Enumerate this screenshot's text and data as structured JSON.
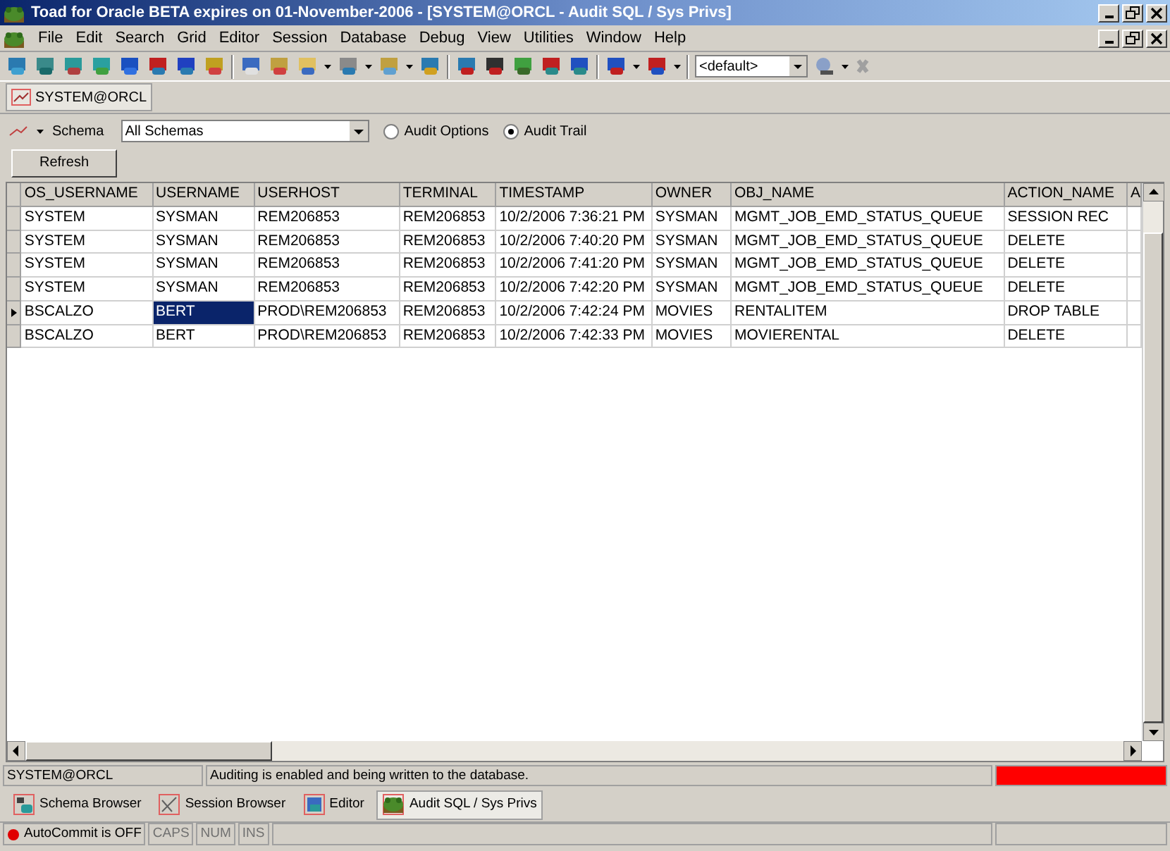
{
  "window": {
    "title": "Toad for Oracle BETA expires on 01-November-2006 - [SYSTEM@ORCL - Audit SQL / Sys Privs]"
  },
  "menu": [
    "File",
    "Edit",
    "Search",
    "Grid",
    "Editor",
    "Session",
    "Database",
    "Debug",
    "View",
    "Utilities",
    "Window",
    "Help"
  ],
  "toolbar": {
    "combo_value": "<default>"
  },
  "connection_tab": {
    "label": "SYSTEM@ORCL"
  },
  "options": {
    "schema_label": "Schema",
    "schema_value": "All Schemas",
    "radios": [
      {
        "label": "Audit Options",
        "selected": false
      },
      {
        "label": "Audit Trail",
        "selected": true
      }
    ]
  },
  "refresh_button": "Refresh",
  "table": {
    "columns": [
      "OS_USERNAME",
      "USERNAME",
      "USERHOST",
      "TERMINAL",
      "TIMESTAMP",
      "OWNER",
      "OBJ_NAME",
      "ACTION_NAME",
      "A"
    ],
    "rows": [
      {
        "current": false,
        "cells": [
          {
            "text": "SYSTEM",
            "selected": false
          },
          {
            "text": "SYSMAN",
            "selected": false
          },
          {
            "text": "REM206853",
            "selected": false
          },
          {
            "text": "REM206853",
            "selected": false
          },
          {
            "text": "10/2/2006 7:36:21 PM",
            "selected": false
          },
          {
            "text": "SYSMAN",
            "selected": false
          },
          {
            "text": "MGMT_JOB_EMD_STATUS_QUEUE",
            "selected": false
          },
          {
            "text": "SESSION REC",
            "selected": false
          }
        ]
      },
      {
        "current": false,
        "cells": [
          {
            "text": "SYSTEM",
            "selected": false
          },
          {
            "text": "SYSMAN",
            "selected": false
          },
          {
            "text": "REM206853",
            "selected": false
          },
          {
            "text": "REM206853",
            "selected": false
          },
          {
            "text": "10/2/2006 7:40:20 PM",
            "selected": false
          },
          {
            "text": "SYSMAN",
            "selected": false
          },
          {
            "text": "MGMT_JOB_EMD_STATUS_QUEUE",
            "selected": false
          },
          {
            "text": "DELETE",
            "selected": false
          }
        ]
      },
      {
        "current": false,
        "cells": [
          {
            "text": "SYSTEM",
            "selected": false
          },
          {
            "text": "SYSMAN",
            "selected": false
          },
          {
            "text": "REM206853",
            "selected": false
          },
          {
            "text": "REM206853",
            "selected": false
          },
          {
            "text": "10/2/2006 7:41:20 PM",
            "selected": false
          },
          {
            "text": "SYSMAN",
            "selected": false
          },
          {
            "text": "MGMT_JOB_EMD_STATUS_QUEUE",
            "selected": false
          },
          {
            "text": "DELETE",
            "selected": false
          }
        ]
      },
      {
        "current": false,
        "cells": [
          {
            "text": "SYSTEM",
            "selected": false
          },
          {
            "text": "SYSMAN",
            "selected": false
          },
          {
            "text": "REM206853",
            "selected": false
          },
          {
            "text": "REM206853",
            "selected": false
          },
          {
            "text": "10/2/2006 7:42:20 PM",
            "selected": false
          },
          {
            "text": "SYSMAN",
            "selected": false
          },
          {
            "text": "MGMT_JOB_EMD_STATUS_QUEUE",
            "selected": false
          },
          {
            "text": "DELETE",
            "selected": false
          }
        ]
      },
      {
        "current": true,
        "cells": [
          {
            "text": "BSCALZO",
            "selected": false
          },
          {
            "text": "BERT",
            "selected": true
          },
          {
            "text": "PROD\\REM206853",
            "selected": false
          },
          {
            "text": "REM206853",
            "selected": false
          },
          {
            "text": "10/2/2006 7:42:24 PM",
            "selected": false
          },
          {
            "text": "MOVIES",
            "selected": false
          },
          {
            "text": "RENTALITEM",
            "selected": false
          },
          {
            "text": "DROP TABLE",
            "selected": false
          }
        ]
      },
      {
        "current": false,
        "cells": [
          {
            "text": "BSCALZO",
            "selected": false
          },
          {
            "text": "BERT",
            "selected": false
          },
          {
            "text": "PROD\\REM206853",
            "selected": false
          },
          {
            "text": "REM206853",
            "selected": false
          },
          {
            "text": "10/2/2006 7:42:33 PM",
            "selected": false
          },
          {
            "text": "MOVIES",
            "selected": false
          },
          {
            "text": "MOVIERENTAL",
            "selected": false
          },
          {
            "text": "DELETE",
            "selected": false
          }
        ]
      }
    ]
  },
  "status_bar": {
    "connection": "SYSTEM@ORCL",
    "message": "Auditing is enabled and being written to the database."
  },
  "window_tabs": [
    {
      "label": "Schema Browser",
      "selected": false
    },
    {
      "label": "Session Browser",
      "selected": false
    },
    {
      "label": "Editor",
      "selected": false
    },
    {
      "label": "Audit SQL / Sys Privs",
      "selected": true
    }
  ],
  "bottom_bar": {
    "autocommit": "AutoCommit is OFF",
    "indicators": [
      {
        "label": "CAPS",
        "disabled": true
      },
      {
        "label": "NUM",
        "disabled": true
      },
      {
        "label": "INS",
        "disabled": true
      }
    ]
  }
}
